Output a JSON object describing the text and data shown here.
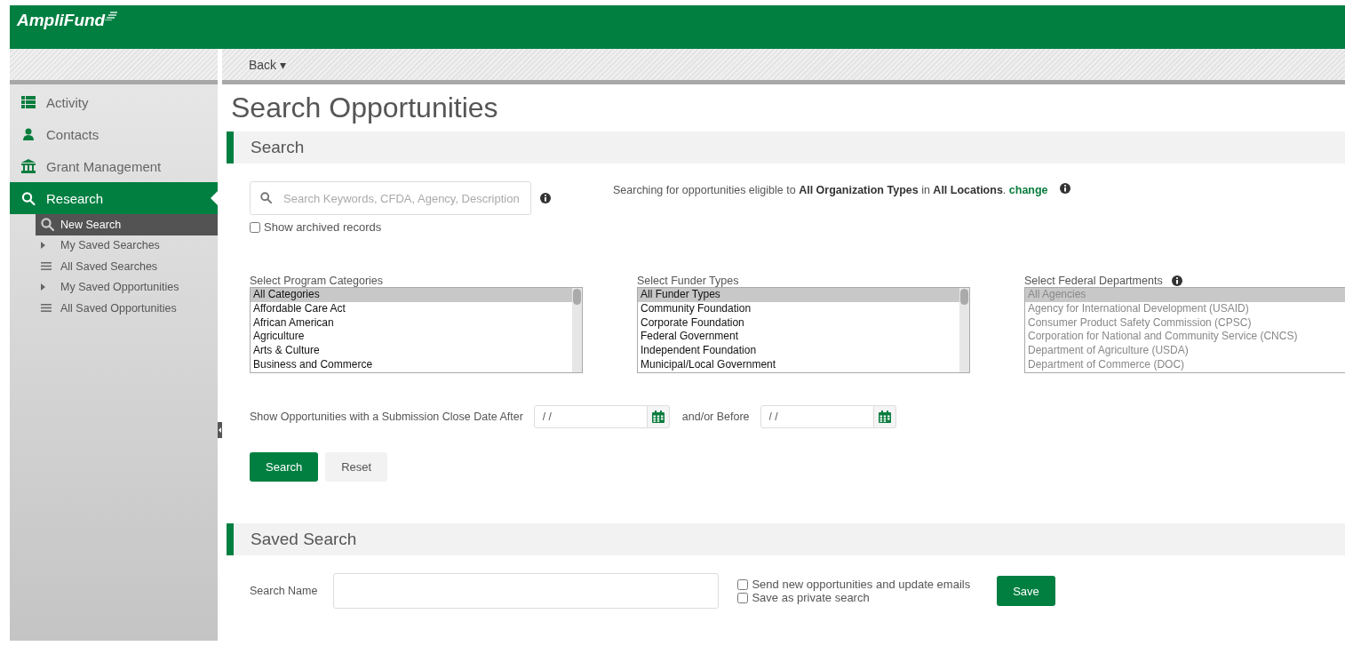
{
  "header": {
    "logo": "AmpliFund"
  },
  "toolbar": {
    "back": "Back ▾"
  },
  "sidebar": {
    "items": [
      {
        "label": "Activity",
        "kind": "list",
        "selected": false
      },
      {
        "label": "Contacts",
        "kind": "person",
        "selected": false
      },
      {
        "label": "Grant Management",
        "kind": "bank",
        "selected": false
      },
      {
        "label": "Research",
        "kind": "search",
        "selected": true,
        "children": [
          {
            "label": "New Search",
            "kind": "search",
            "selected": true
          },
          {
            "label": "My Saved Searches",
            "kind": "folder",
            "selected": false
          },
          {
            "label": "All Saved Searches",
            "kind": "list",
            "selected": false
          },
          {
            "label": "My Saved Opportunities",
            "kind": "folder",
            "selected": false
          },
          {
            "label": "All Saved Opportunities",
            "kind": "list",
            "selected": false
          }
        ]
      }
    ]
  },
  "page": {
    "title": "Search Opportunities"
  },
  "search_section": {
    "title": "Search",
    "keyword_field": {
      "placeholder": "Search Keywords, CFDA, Agency, Description"
    },
    "show_archived": {
      "label": "Show archived records",
      "checked": false
    },
    "eligibility_text": "Searching for opportunities eligible to **All Organization Types** in **All Locations**.",
    "eligibility_link": "change",
    "listboxes": [
      {
        "label": "Select Program Categories",
        "disabled": false,
        "options": [
          {
            "label": "All Categories",
            "selected": true
          },
          {
            "label": "Affordable Care Act",
            "selected": false
          },
          {
            "label": "African American",
            "selected": false
          },
          {
            "label": "Agriculture",
            "selected": false
          },
          {
            "label": "Arts & Culture",
            "selected": false
          },
          {
            "label": "Business and Commerce",
            "selected": false
          }
        ]
      },
      {
        "label": "Select Funder Types",
        "disabled": false,
        "options": [
          {
            "label": "All Funder Types",
            "selected": true
          },
          {
            "label": "Community Foundation",
            "selected": false
          },
          {
            "label": "Corporate Foundation",
            "selected": false
          },
          {
            "label": "Federal Government",
            "selected": false
          },
          {
            "label": "Independent Foundation",
            "selected": false
          },
          {
            "label": "Municipal/Local Government",
            "selected": false
          }
        ]
      },
      {
        "label": "Select Federal Departments",
        "disabled": true,
        "options": [
          {
            "label": "All Agencies",
            "selected": true
          },
          {
            "label": "Agency for International Development (USAID)",
            "selected": false
          },
          {
            "label": "Consumer Product Safety Commission (CPSC)",
            "selected": false
          },
          {
            "label": "Corporation for National and Community Service (CNCS)",
            "selected": false
          },
          {
            "label": "Department of Agriculture (USDA)",
            "selected": false
          },
          {
            "label": "Department of Commerce (DOC)",
            "selected": false
          }
        ]
      }
    ],
    "date_label": "Show Opportunities with a Submission Close Date After",
    "date_after": {
      "value": "/ /"
    },
    "date_between": "and/or Before",
    "date_before": {
      "value": "/ /"
    },
    "buttons": [
      {
        "label": "Search",
        "kind": "primary"
      },
      {
        "label": "Reset",
        "kind": "secondary"
      }
    ]
  },
  "saved_section": {
    "title": "Saved Search",
    "name_label": "Search Name",
    "options": [
      {
        "label": "Send new opportunities and update emails",
        "checked": false
      },
      {
        "label": "Save as private search",
        "checked": false
      }
    ],
    "save_button": "Save"
  }
}
